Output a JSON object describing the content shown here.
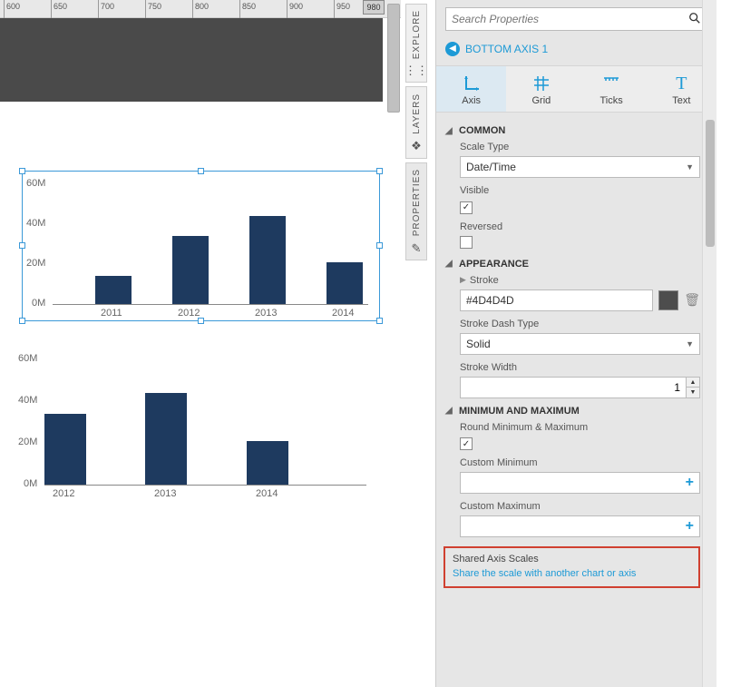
{
  "ruler": {
    "ticks": [
      "600",
      "650",
      "700",
      "750",
      "800",
      "850",
      "900",
      "950"
    ],
    "cursor": "980"
  },
  "chart_data": [
    {
      "type": "bar",
      "categories": [
        "2011",
        "2012",
        "2013",
        "2014"
      ],
      "values": [
        14,
        34,
        44,
        21
      ],
      "ylabel": "",
      "ylim": [
        0,
        60
      ],
      "yticks": [
        "0M",
        "20M",
        "40M",
        "60M"
      ]
    },
    {
      "type": "bar",
      "categories": [
        "2012",
        "2013",
        "2014"
      ],
      "values": [
        34,
        44,
        21
      ],
      "ylabel": "",
      "ylim": [
        0,
        60
      ],
      "yticks": [
        "0M",
        "20M",
        "40M",
        "60M"
      ]
    }
  ],
  "side_tabs": {
    "explore": "EXPLORE",
    "layers": "LAYERS",
    "properties": "PROPERTIES"
  },
  "search": {
    "placeholder": "Search Properties"
  },
  "breadcrumb": {
    "text": "BOTTOM AXIS 1"
  },
  "toolbar": {
    "axis": "Axis",
    "grid": "Grid",
    "ticks": "Ticks",
    "text": "Text"
  },
  "groups": {
    "common": "COMMON",
    "scale_type_label": "Scale Type",
    "scale_type_value": "Date/Time",
    "visible_label": "Visible",
    "reversed_label": "Reversed",
    "appearance": "APPEARANCE",
    "stroke_label": "Stroke",
    "stroke_value": "#4D4D4D",
    "dash_label": "Stroke Dash Type",
    "dash_value": "Solid",
    "width_label": "Stroke Width",
    "width_value": "1",
    "minmax": "MINIMUM AND MAXIMUM",
    "round_label": "Round Minimum & Maximum",
    "cmin_label": "Custom Minimum",
    "cmax_label": "Custom Maximum",
    "shared_label": "Shared Axis Scales",
    "shared_link": "Share the scale with another chart or axis"
  }
}
